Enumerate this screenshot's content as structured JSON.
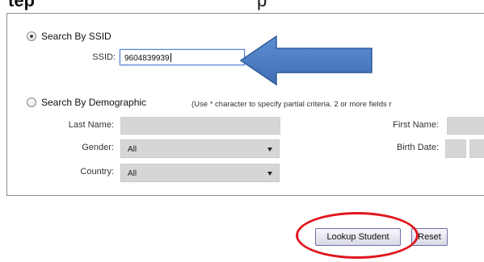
{
  "header_fragments": {
    "left": "tep",
    "right": "p"
  },
  "ssid_section": {
    "radio_label": "Search By SSID",
    "field_label": "SSID:",
    "value": "9604839939"
  },
  "demographic_section": {
    "radio_label": "Search By Demographic",
    "note": "(Use * character to specify partial criteria. 2 or more fields r",
    "last_name_label": "Last Name:",
    "first_name_label": "First Name:",
    "gender_label": "Gender:",
    "gender_value": "All",
    "birth_date_label": "Birth Date:",
    "country_label": "Country:",
    "country_value": "All"
  },
  "buttons": {
    "lookup": "Lookup Student",
    "reset": "Reset"
  },
  "colors": {
    "arrow": "#4f80c4",
    "highlight_ellipse": "#e0161d",
    "input_gray": "#d6d6d6"
  }
}
